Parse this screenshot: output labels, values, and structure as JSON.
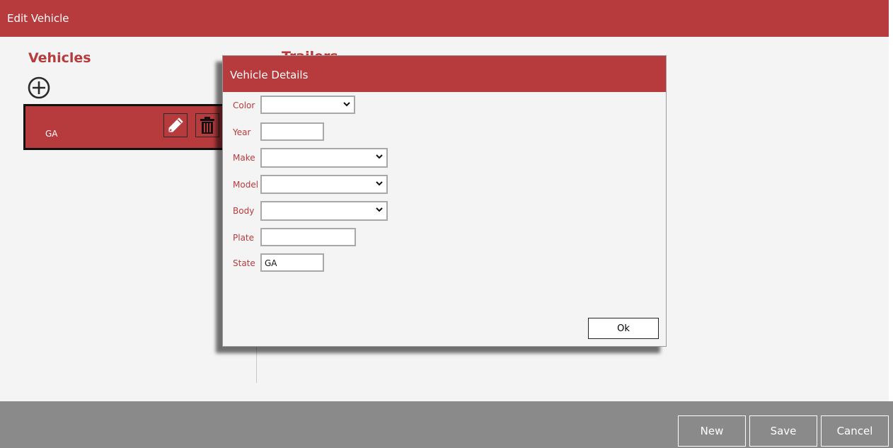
{
  "window": {
    "title": "Edit Vehicle"
  },
  "vehicles": {
    "section_title": "Vehicles",
    "add_icon": "add-circle-icon",
    "items": [
      {
        "label": "GA"
      }
    ]
  },
  "trailers": {
    "section_title": "Trailers"
  },
  "dialog": {
    "title": "Vehicle Details",
    "fields": {
      "color": {
        "label": "Color",
        "value": ""
      },
      "year": {
        "label": "Year",
        "value": ""
      },
      "make": {
        "label": "Make",
        "value": ""
      },
      "model": {
        "label": "Model",
        "value": ""
      },
      "body": {
        "label": "Body",
        "value": ""
      },
      "plate": {
        "label": "Plate",
        "value": ""
      },
      "state": {
        "label": "State",
        "value": "GA"
      }
    },
    "ok_label": "Ok"
  },
  "actions": {
    "new_label": "New",
    "save_label": "Save",
    "cancel_label": "Cancel"
  },
  "colors": {
    "accent": "#b73a3d",
    "background": "#f4f4f4",
    "bottom_bar": "#8a8a8a"
  }
}
